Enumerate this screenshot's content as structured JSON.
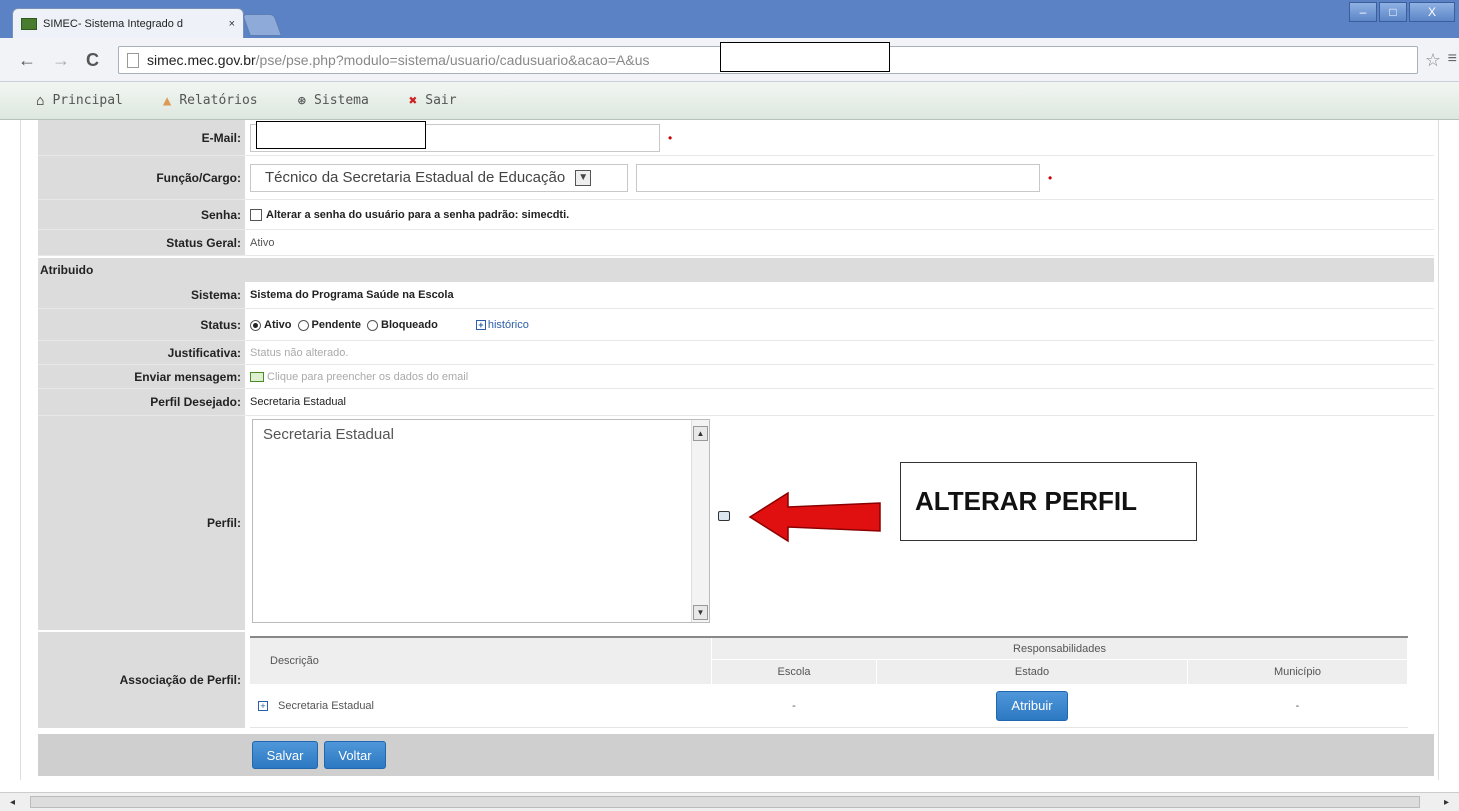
{
  "browser": {
    "tab_title": "SIMEC- Sistema Integrado d",
    "tab_close": "×",
    "url_host": "simec.mec.gov.br",
    "url_path": "/pse/pse.php?modulo=sistema/usuario/cadusuario&acao=A&us",
    "window_buttons": [
      "–",
      "□",
      "X"
    ],
    "back": "←",
    "forward": "→",
    "reload": "C",
    "star": "☆",
    "menu": "≡"
  },
  "nav": {
    "items": [
      {
        "label": "Principal",
        "icon": "home-icon",
        "glyph": "⌂"
      },
      {
        "label": "Relatórios",
        "icon": "chart-icon",
        "glyph": "▲"
      },
      {
        "label": "Sistema",
        "icon": "gear-icon",
        "glyph": "⊛"
      },
      {
        "label": "Sair",
        "icon": "exit-icon",
        "glyph": "✖"
      }
    ]
  },
  "form": {
    "email_label": "E-Mail:",
    "funcao_label": "Função/Cargo:",
    "funcao_value": "Técnico da Secretaria Estadual de Educação",
    "senha_label": "Senha:",
    "senha_text": "Alterar a senha do usuário para a senha padrão: simecdti.",
    "status_geral_label": "Status Geral:",
    "status_geral_value": "Ativo",
    "atribuido_section": "Atribuido",
    "sistema_label": "Sistema:",
    "sistema_value": "Sistema do Programa Saúde na Escola",
    "status_label": "Status:",
    "status_options": [
      "Ativo",
      "Pendente",
      "Bloqueado"
    ],
    "status_selected": "Ativo",
    "historico_link": "histórico",
    "justificativa_label": "Justificativa:",
    "justificativa_value": "Status não alterado.",
    "mensagem_label": "Enviar mensagem:",
    "mensagem_value": "Clique para preencher os dados do email",
    "perfil_desejado_label": "Perfil Desejado:",
    "perfil_desejado_value": "Secretaria Estadual",
    "perfil_label": "Perfil:",
    "perfil_list_item": "Secretaria Estadual",
    "annotation": "ALTERAR PERFIL",
    "associacao_label": "Associação de Perfil:"
  },
  "assoc_table": {
    "col_descricao": "Descrição",
    "col_responsabilidades": "Responsabilidades",
    "sub_cols": [
      "Escola",
      "Estado",
      "Município"
    ],
    "row": {
      "descricao": "Secretaria Estadual",
      "escola": "-",
      "estado_button": "Atribuir",
      "municipio": "-"
    }
  },
  "actions": {
    "salvar": "Salvar",
    "voltar": "Voltar"
  },
  "colors": {
    "titlebar": "#5b82c4",
    "label_bg": "#dcdcdc",
    "button_blue": "#2c78c2",
    "required_red": "#cc0000",
    "arrow_red": "#e01010"
  }
}
